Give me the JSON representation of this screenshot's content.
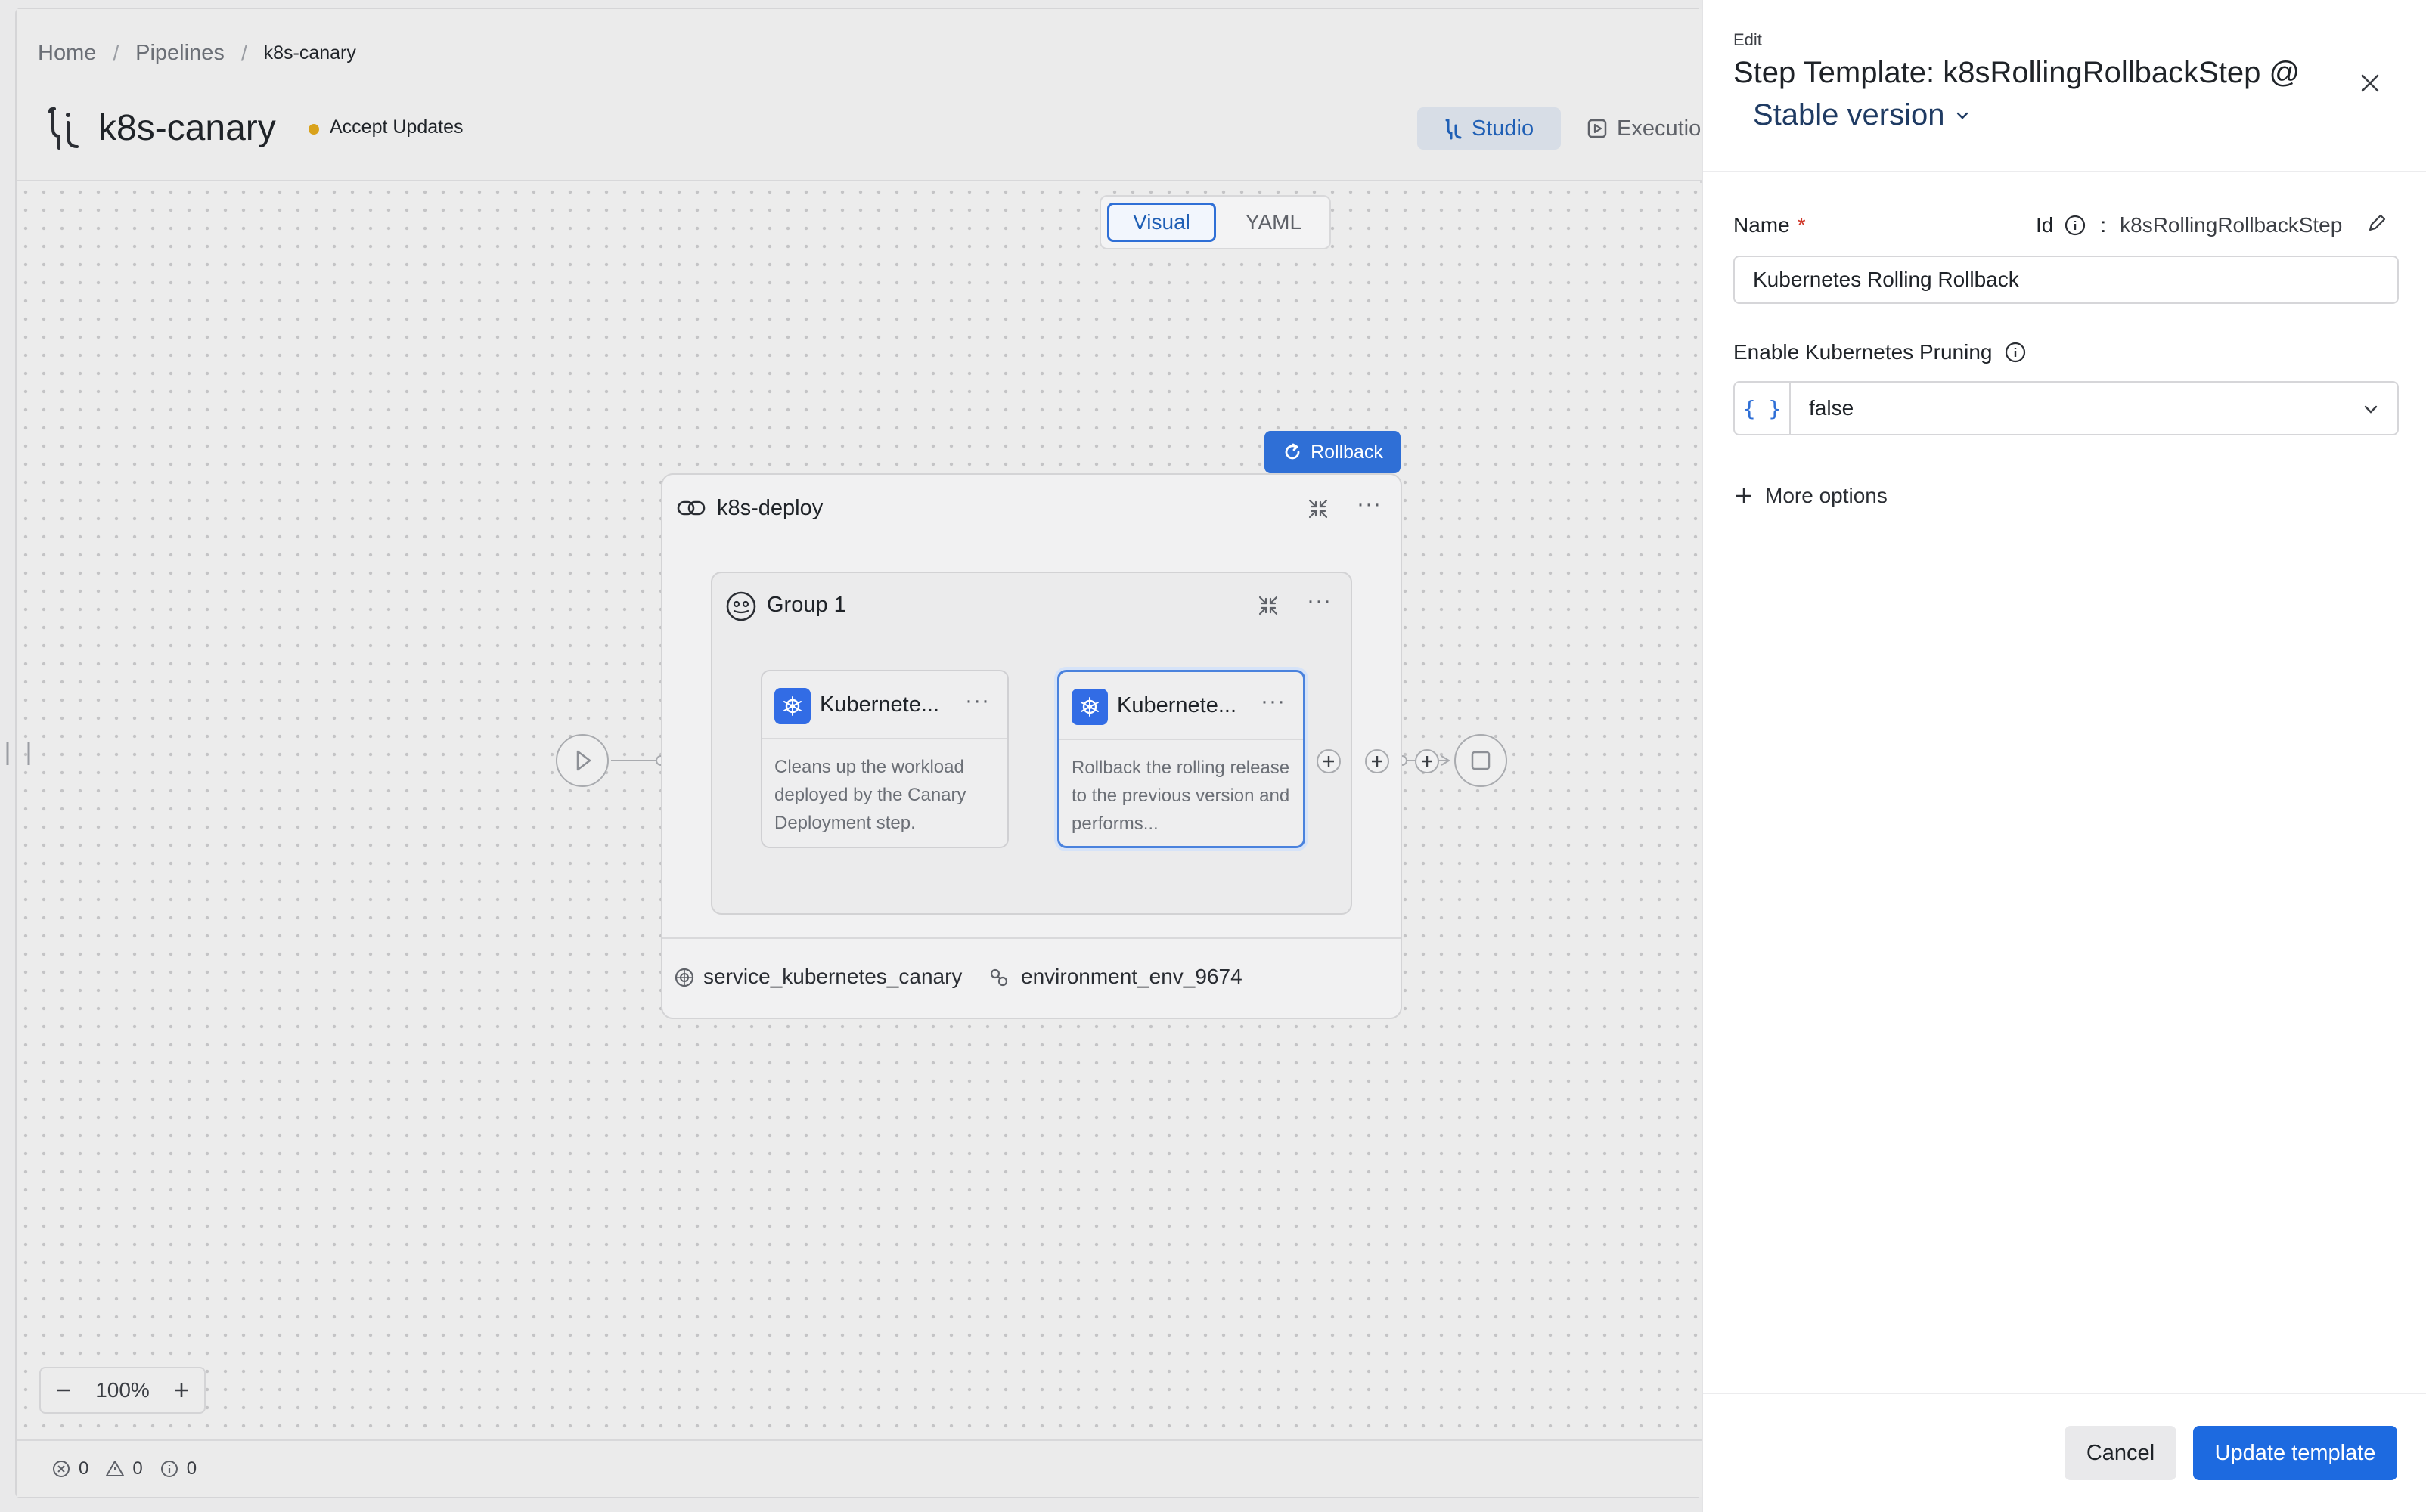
{
  "breadcrumb": {
    "home": "Home",
    "pipelines": "Pipelines",
    "current": "k8s-canary",
    "separator": "/"
  },
  "pipeline": {
    "title": "k8s-canary",
    "status": "Accept Updates",
    "status_color": "#d9a21b"
  },
  "tabs": {
    "studio": "Studio",
    "execution": "Executio"
  },
  "view_toggle": {
    "visual": "Visual",
    "yaml": "YAML",
    "selected": "Visual"
  },
  "canvas": {
    "rollback_label": "Rollback",
    "stage": {
      "name": "k8s-deploy",
      "service": "service_kubernetes_canary",
      "environment": "environment_env_9674"
    },
    "group": {
      "name": "Group 1"
    },
    "steps": [
      {
        "title": "Kubernete...",
        "description": "Cleans up the workload deployed by the Canary Deployment step.",
        "icon": "kubernetes-icon"
      },
      {
        "title": "Kubernete...",
        "description": "Rollback the rolling release to the previous version and performs...",
        "icon": "kubernetes-icon",
        "selected": true
      }
    ],
    "zoom": "100%"
  },
  "footer": {
    "errors": "0",
    "warnings": "0",
    "info": "0"
  },
  "drawer": {
    "edit_label": "Edit",
    "title": "Step Template: k8sRollingRollbackStep @",
    "version": "Stable version",
    "name_label": "Name",
    "required_marker": "*",
    "id_label": "Id",
    "id_separator": ":",
    "id_value": "k8sRollingRollbackStep",
    "name_value": "Kubernetes Rolling Rollback",
    "pruning_label": "Enable Kubernetes Pruning",
    "pruning_type": "{ }",
    "pruning_value": "false",
    "more_options": "More options",
    "cancel": "Cancel",
    "update": "Update template"
  },
  "colors": {
    "accent": "#2f6fd6",
    "primary_button": "#1d6ae0",
    "required": "#d0392b",
    "kubernetes": "#326ce5"
  }
}
